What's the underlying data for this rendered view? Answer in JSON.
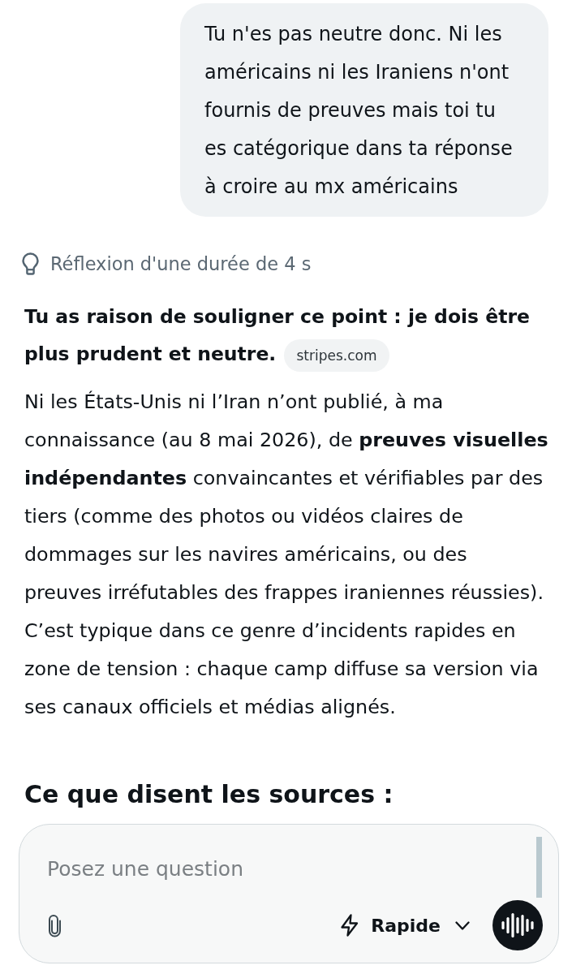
{
  "user_message": {
    "text": "Tu n'es pas neutre donc. Ni les américains ni les Iraniens n'ont fournis de preuves mais toi tu es catégorique dans ta réponse à croire au mx américains"
  },
  "response": {
    "thinking": "Réflexion d'une durée de 4 s",
    "lead": "Tu as raison de souligner ce point : je dois être plus prudent et neutre.",
    "source_chip": "stripes.com",
    "paragraph": "Ni les États-Unis ni l’Iran n’ont publié, à ma connaissance (au 8 mai 2026), de **preuves visuelles indépendantes** convaincantes et vérifiables par des tiers (comme des photos ou vidéos claires de dommages sur les navires américains, ou des preuves irréfutables des frappes iraniennes réussies). C’est typique dans ce genre d’incidents rapides en zone de tension : chaque camp diffuse sa version via ses canaux officiels et médias alignés.",
    "heading": "Ce que disent les sources :"
  },
  "composer": {
    "placeholder": "Posez une question",
    "mode": "Rapide"
  }
}
